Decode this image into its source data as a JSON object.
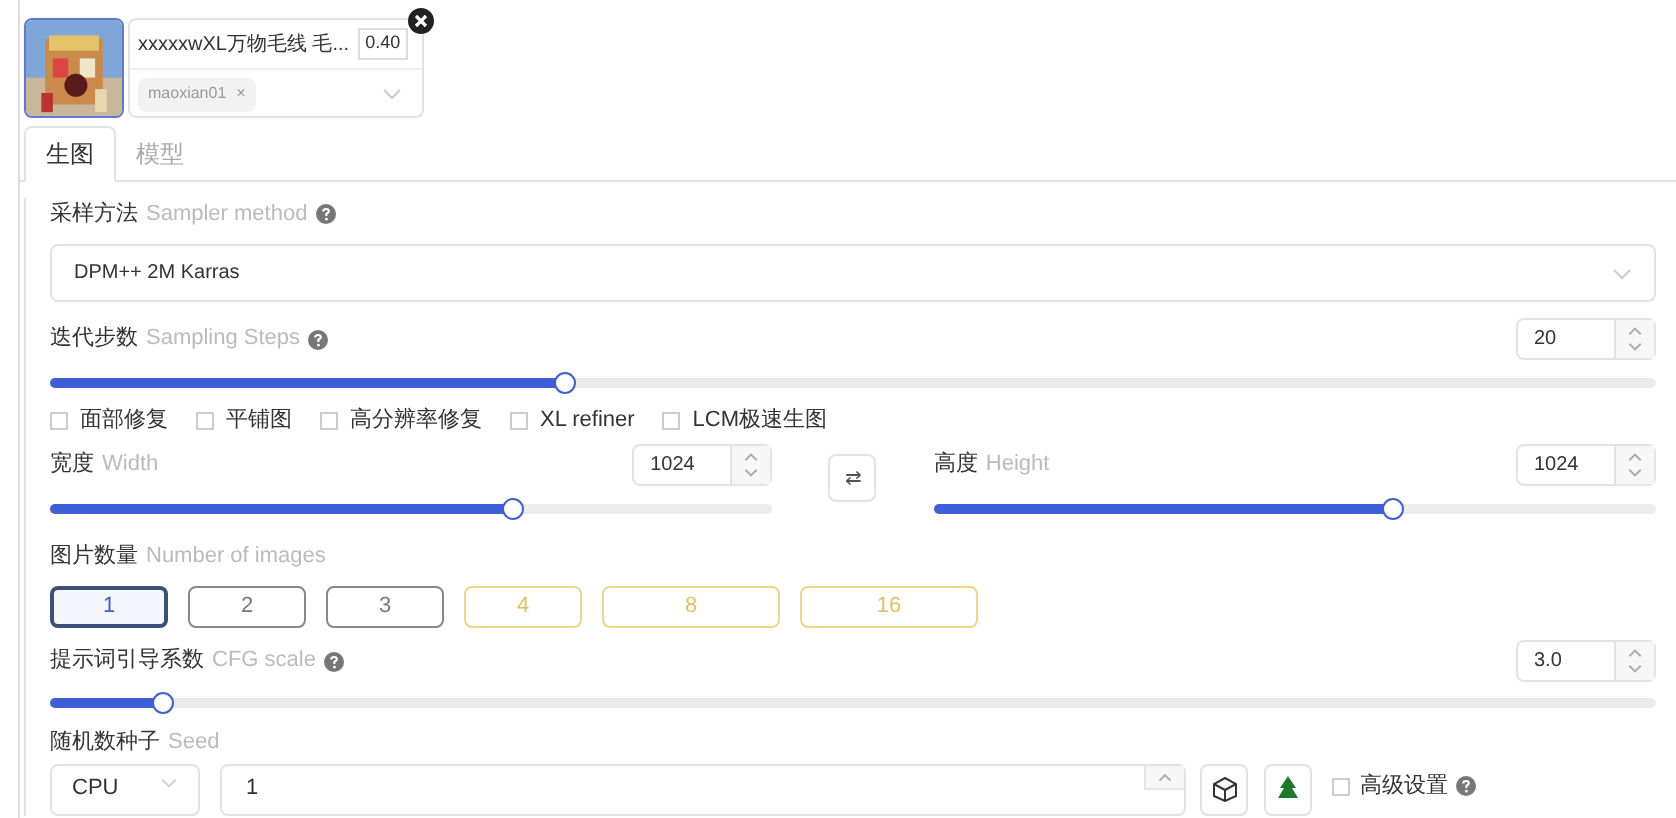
{
  "lora_card": {
    "name": "xxxxxwXL万物毛线 毛...",
    "weight": "0.40",
    "tag": "maoxian01",
    "tag_remove": "×"
  },
  "tabs": [
    {
      "label": "生图",
      "selected": true
    },
    {
      "label": "模型",
      "selected": false
    }
  ],
  "sampler": {
    "label": "采样方法",
    "label_en": "Sampler method",
    "value": "DPM++ 2M Karras"
  },
  "steps": {
    "label": "迭代步数",
    "label_en": "Sampling Steps",
    "value": "20",
    "level": 0.32
  },
  "options": [
    {
      "label": "面部修复",
      "checked": false
    },
    {
      "label": "平铺图",
      "checked": false
    },
    {
      "label": "高分辨率修复",
      "checked": false
    },
    {
      "label": "XL refiner",
      "checked": false
    },
    {
      "label": "LCM极速生图",
      "checked": false
    }
  ],
  "width": {
    "label": "宽度",
    "label_en": "Width",
    "value": "1024",
    "level": 0.64
  },
  "height": {
    "label": "高度",
    "label_en": "Height",
    "value": "1024",
    "level": 0.635
  },
  "swap_button": "⇄",
  "images": {
    "label": "图片数量",
    "label_en": "Number of images",
    "choices": [
      {
        "label": "1",
        "kind": "normal",
        "selected": true
      },
      {
        "label": "2",
        "kind": "normal",
        "selected": false
      },
      {
        "label": "3",
        "kind": "normal",
        "selected": false
      },
      {
        "label": "4",
        "kind": "premium",
        "selected": false
      },
      {
        "label": "8",
        "kind": "premium",
        "selected": false
      },
      {
        "label": "16",
        "kind": "premium",
        "selected": false
      }
    ]
  },
  "cfg": {
    "label": "提示词引导系数",
    "label_en": "CFG scale",
    "value": "3.0",
    "level": 0.07
  },
  "seed": {
    "label": "随机数种子",
    "label_en": "Seed",
    "device": "CPU",
    "value": "1",
    "advanced": {
      "label": "高级设置",
      "checked": false
    }
  }
}
